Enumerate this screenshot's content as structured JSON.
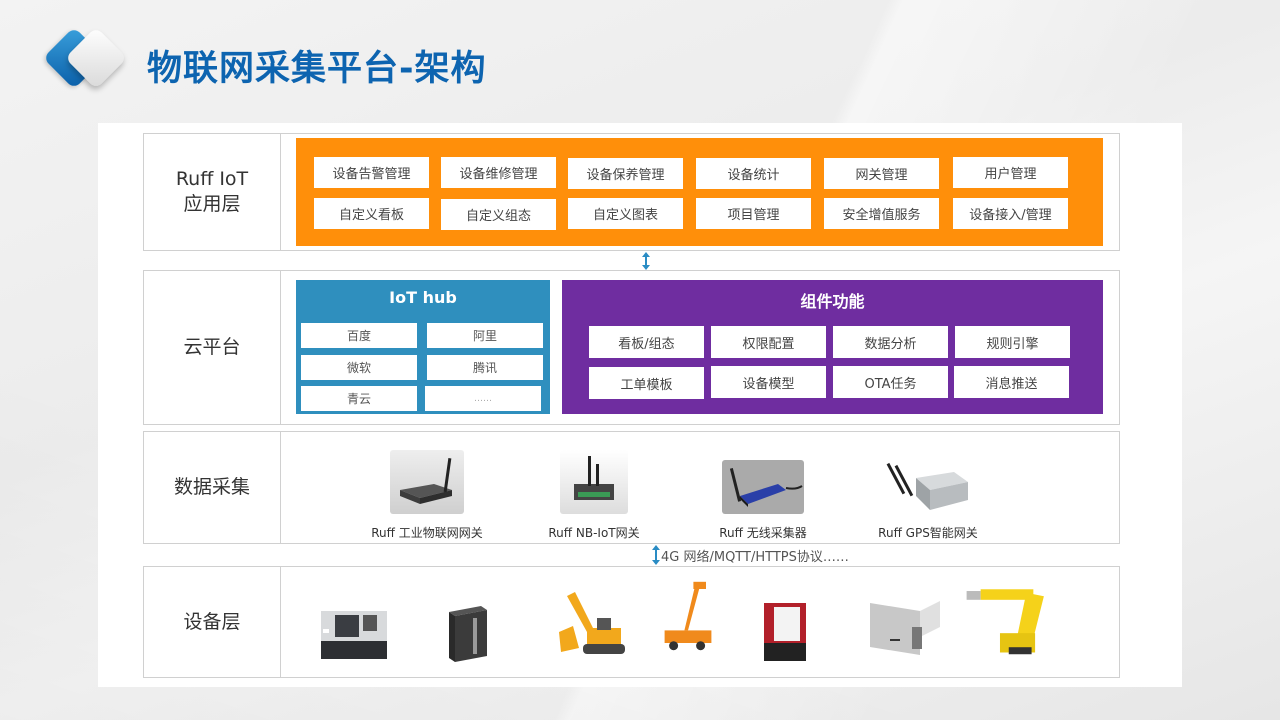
{
  "slide": {
    "title": "物联网采集平台-架构"
  },
  "layers": {
    "application": {
      "label_line1": "Ruff IoT",
      "label_line2": "应用层",
      "color": "#ff8f0a",
      "items_row1": [
        "设备告警管理",
        "设备维修管理",
        "设备保养管理",
        "设备统计",
        "网关管理",
        "用户管理"
      ],
      "items_row2": [
        "自定义看板",
        "自定义组态",
        "自定义图表",
        "项目管理",
        "安全增值服务",
        "设备接入/管理"
      ]
    },
    "cloud": {
      "label": "云平台",
      "iot_hub": {
        "title": "IoT hub",
        "color": "#2f8fbe",
        "items": [
          "百度",
          "阿里",
          "微软",
          "腾讯",
          "青云",
          "……"
        ]
      },
      "components": {
        "title": "组件功能",
        "color": "#6f2da0",
        "items_row1": [
          "看板/组态",
          "权限配置",
          "数据分析",
          "规则引擎"
        ],
        "items_row2": [
          "工单模板",
          "设备模型",
          "OTA任务",
          "消息推送"
        ]
      }
    },
    "data_collection": {
      "label": "数据采集",
      "gateways": [
        {
          "name": "Ruff 工业物联网网关",
          "icon": "industrial-gateway-icon"
        },
        {
          "name": "Ruff NB-IoT网关",
          "icon": "nb-iot-gateway-icon"
        },
        {
          "name": "Ruff 无线采集器",
          "icon": "wireless-collector-icon"
        },
        {
          "name": "Ruff GPS智能网关",
          "icon": "gps-gateway-icon"
        }
      ]
    },
    "protocol": "4G 网络/MQTT/HTTPS协议……",
    "devices": {
      "label": "设备层",
      "items": [
        "cnc-lathe-icon",
        "plc-module-icon",
        "excavator-icon",
        "aerial-lift-truck-icon",
        "controller-box-icon",
        "industrial-equipment-icon",
        "robot-arm-icon"
      ]
    }
  },
  "colors": {
    "title_blue": "#0d64b0",
    "arrow_blue": "#2a8cc4"
  }
}
